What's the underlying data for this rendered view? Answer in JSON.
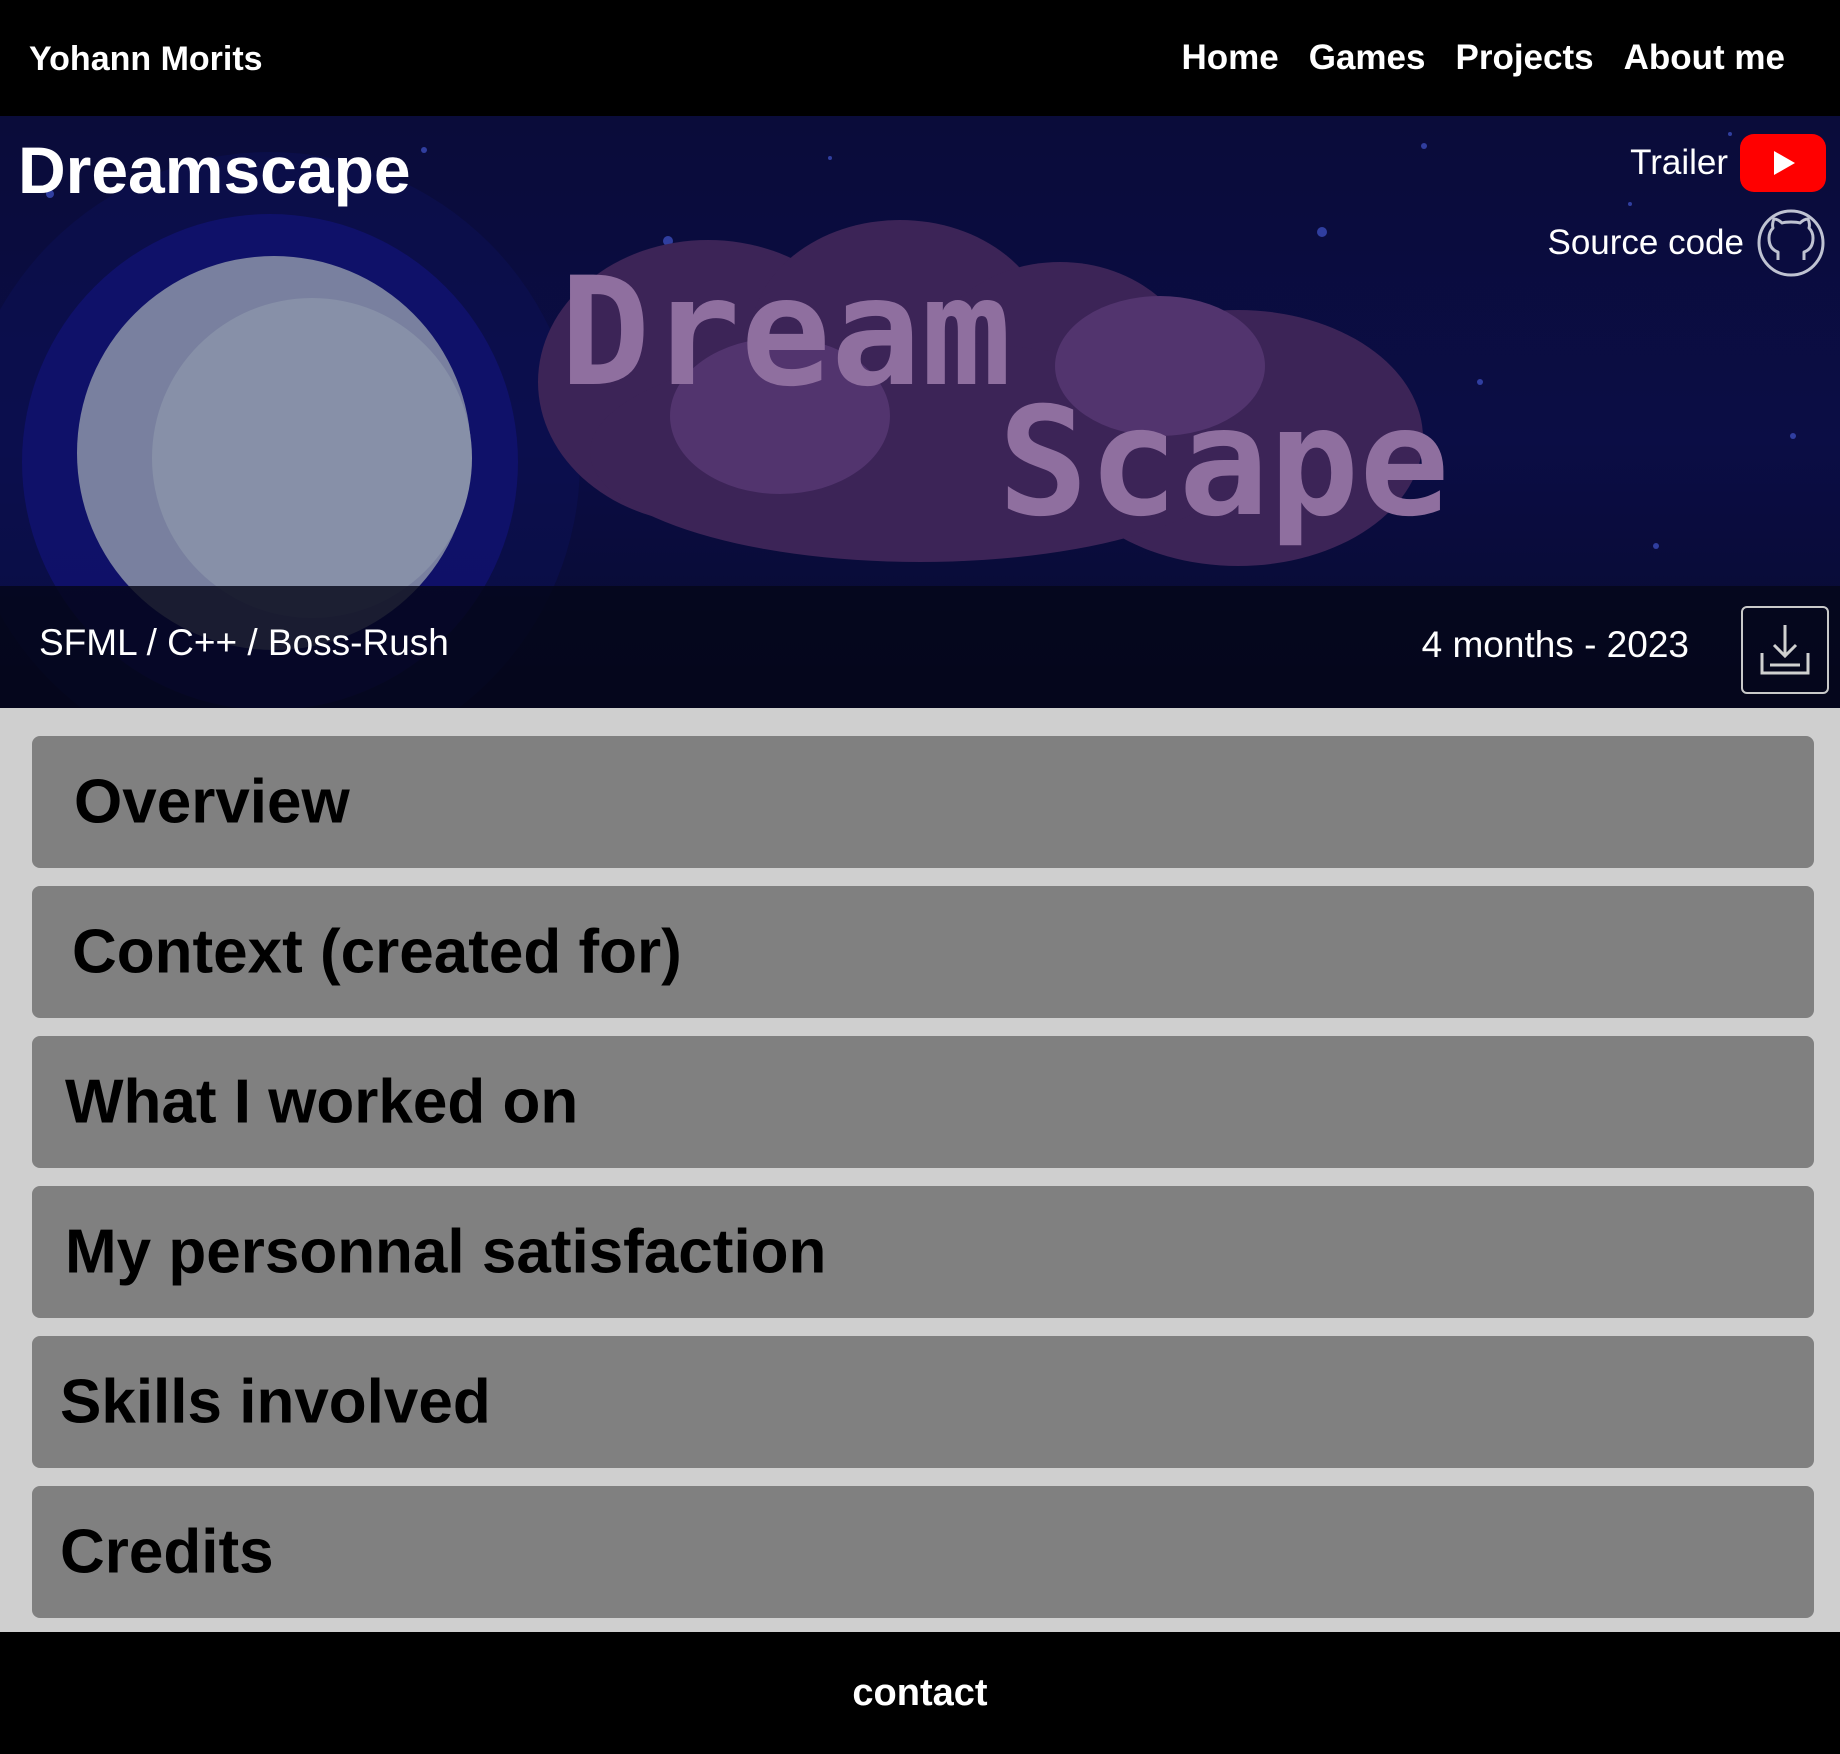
{
  "site": {
    "name": "Yohann Morits"
  },
  "nav": {
    "items": [
      "Home",
      "Games",
      "Projects",
      "About me"
    ]
  },
  "project": {
    "title": "Dreamscape",
    "logo_text": [
      "Dream",
      "Scape"
    ],
    "trailer_label": "Trailer",
    "source_label": "Source code",
    "tags": "SFML / C++ / Boss-Rush",
    "duration": "4 months - 2023"
  },
  "sections": [
    "Overview",
    "Context (created for)",
    "What I worked on",
    "My personnal satisfaction",
    "Skills involved",
    "Credits"
  ],
  "footer": {
    "contact": "contact"
  },
  "colors": {
    "youtube": "#ff0000",
    "section_bg": "#808080",
    "page_bg": "#cfcfcf"
  }
}
